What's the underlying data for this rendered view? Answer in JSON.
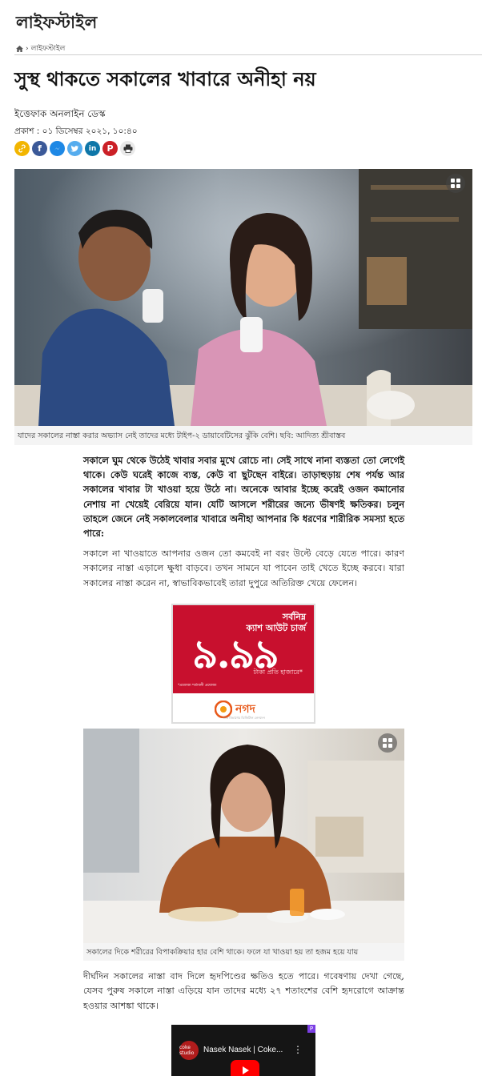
{
  "section": {
    "title": "লাইফস্টাইল"
  },
  "breadcrumb": {
    "separator": "›",
    "current": "লাইফস্টাইল"
  },
  "article": {
    "headline": "সুস্থ থাকতে সকালের খাবারে অনীহা নয়",
    "byline": "ইত্তেফাক অনলাইন ডেস্ক",
    "published": "প্রকাশ : ০১ ডিসেম্বর ২০২১, ১০:৪০",
    "hero_caption": "যাদের সকালের নাস্তা করার অভ্যাস নেই তাদের মধ্যে টাইপ-২ ডায়াবেটিসের ঝুঁকি বেশি। ছবি: আদিত্য শ্রীবাস্তব",
    "lead": "সকালে ঘুম থেকে উঠেই খাবার সবার মুখে রোচে না। সেই সাথে নানা ব্যস্ততা তো লেগেই থাকে। কেউ ঘরেই কাজে ব্যস্ত, কেউ বা ছুটছেন বাইরে। তাড়াহুড়ায় শেষ পর্যন্ত আর সকালের খাবার টা খাওয়া হয়ে উঠে না। অনেকে আবার ইচ্ছে করেই ওজন কমানোর নেশায় না খেয়েই বেরিয়ে যান। যেটি আসলে শরীরের জন্যে ভীষণই ক্ষতিকর। চলুন তাহলে জেনে নেই সকালবেলার খাবারে অনীহা আপনার কি ধরণের শারীরিক সমস্যা হতে পারে:",
    "para1": "সকালে না খাওয়াতে আপনার ওজন তো কমবেই না বরং উল্টে বেড়ে যেতে পারে। কারণ সকালের নাস্তা এড়ালে ক্ষুধা বাড়বে। তখন সামনে যা পাবেন তাই খেতে ইচ্ছে করবে। যারা সকালের নাস্তা করেন না, স্বাভাবিকভাবেই তারা দুপুরে অতিরিক্ত খেয়ে ফেলেন।",
    "image2_caption": "সকালের দিকে শরীরের বিপাকক্রিয়ার হার বেশি থাকে। ফলে যা খাওয়া হয় তা হজম হয়ে যায়",
    "para2": "দীর্ঘদিন সকালের নাস্তা বাদ দিলে হৃদপিণ্ডের ক্ষতিও হতে পারে। গবেষণায় দেখা গেছে, যেসব পুরুষ সকালে নাস্তা এড়িয়ে যান তাদের মধ্যে ২৭ শতাংশের বেশি হৃদরোগে আক্রান্ত হওয়ার আশঙ্কা থাকে।"
  },
  "share_icons": [
    "link-icon",
    "facebook-icon",
    "messenger-icon",
    "twitter-icon",
    "linkedin-icon",
    "pinterest-icon",
    "print-icon"
  ],
  "ad": {
    "line1": "সর্বনিম্ন",
    "line2": "ক্যাশ আউট চার্জ",
    "amount": "৯.৯৯",
    "unit": "টাকা প্রতি হাজারে*",
    "fine_print": "*প্রযোজ্য শর্তাবলী প্রযোজ্য",
    "brand": "নগদ",
    "tagline": "ডাক বিভাগের ডিজিটাল লেনদেন"
  },
  "video": {
    "title": "Nasek Nasek | Coke...",
    "channel_logo": "coke studio"
  },
  "colors": {
    "ad_red": "#c8102e",
    "brand_orange": "#e8591a"
  }
}
